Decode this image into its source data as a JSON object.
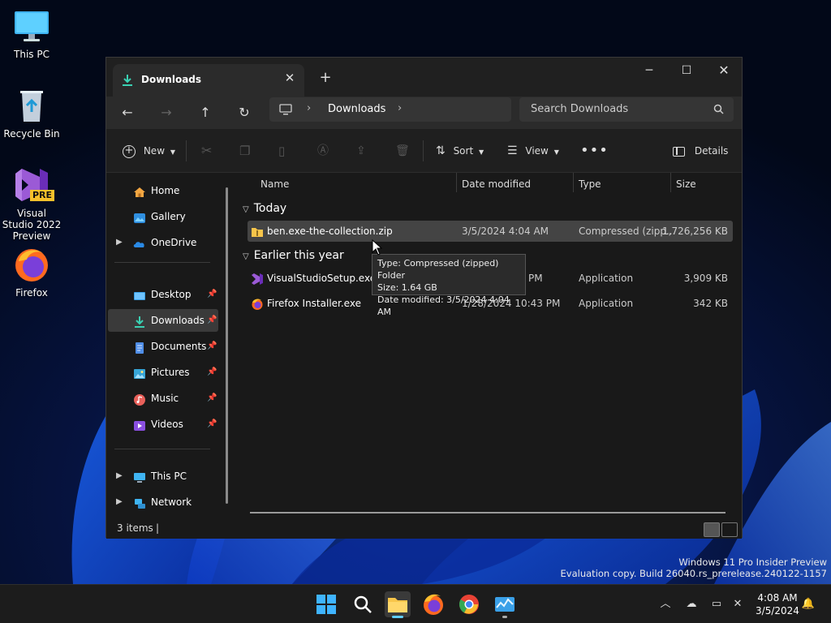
{
  "desktop": {
    "icons": [
      {
        "label": "This PC"
      },
      {
        "label": "Recycle Bin"
      },
      {
        "label": "Visual Studio 2022 Preview",
        "badge": "PRE"
      },
      {
        "label": "Firefox"
      }
    ]
  },
  "window": {
    "tab_title": "Downloads",
    "search_placeholder": "Search Downloads",
    "breadcrumb": [
      "Downloads"
    ]
  },
  "toolbar": {
    "new_label": "New",
    "sort_label": "Sort",
    "view_label": "View",
    "details_label": "Details"
  },
  "nav": {
    "home": "Home",
    "gallery": "Gallery",
    "onedrive": "OneDrive",
    "desktop": "Desktop",
    "downloads": "Downloads",
    "documents": "Documents",
    "pictures": "Pictures",
    "music": "Music",
    "videos": "Videos",
    "thispc": "This PC",
    "network": "Network"
  },
  "columns": {
    "name": "Name",
    "date": "Date modified",
    "type": "Type",
    "size": "Size"
  },
  "groups": {
    "today": "Today",
    "earlier": "Earlier this year"
  },
  "files": [
    {
      "name": "ben.exe-the-collection.zip",
      "date": "3/5/2024 4:04 AM",
      "type": "Compressed (zipp...",
      "size": "1,726,256 KB"
    },
    {
      "name": "VisualStudioSetup.exe",
      "date": "PM",
      "type": "Application",
      "size": "3,909 KB"
    },
    {
      "name": "Firefox Installer.exe",
      "date": "1/28/2024 10:43 PM",
      "type": "Application",
      "size": "342 KB"
    }
  ],
  "tooltip": {
    "line1": "Type: Compressed (zipped) Folder",
    "line2": "Size: 1.64 GB",
    "line3": "Date modified: 3/5/2024 4:04 AM"
  },
  "status": {
    "count": "3 items",
    "caret": "|"
  },
  "watermark": {
    "line1": "Windows 11 Pro Insider Preview",
    "line2": "Evaluation copy. Build 26040.rs_prerelease.240122-1157"
  },
  "clock": {
    "time": "4:08 AM",
    "date": "3/5/2024"
  },
  "colors": {
    "accent": "#60cdff",
    "folder": "#f8c54a",
    "selection": "#444444"
  }
}
